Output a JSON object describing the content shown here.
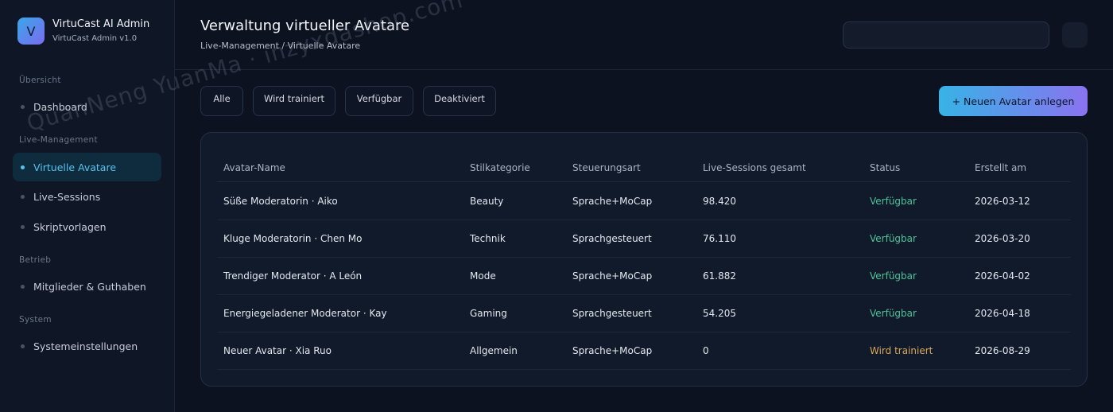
{
  "brand": {
    "logo_letter": "V",
    "title": "VirtuCast AI Admin",
    "subtitle": "VirtuCast Admin v1.0"
  },
  "sidebar": {
    "sections": [
      {
        "label": "Übersicht",
        "items": [
          {
            "label": "Dashboard",
            "active": false
          }
        ]
      },
      {
        "label": "Live-Management",
        "items": [
          {
            "label": "Virtuelle Avatare",
            "active": true
          },
          {
            "label": "Live-Sessions",
            "active": false
          },
          {
            "label": "Skriptvorlagen",
            "active": false
          }
        ]
      },
      {
        "label": "Betrieb",
        "items": [
          {
            "label": "Mitglieder & Guthaben",
            "active": false
          }
        ]
      },
      {
        "label": "System",
        "items": [
          {
            "label": "Systemeinstellungen",
            "active": false
          }
        ]
      }
    ]
  },
  "header": {
    "title": "Verwaltung virtueller Avatare",
    "breadcrumb": "Live-Management / Virtuelle Avatare",
    "search": {
      "value": "",
      "placeholder": ""
    }
  },
  "filters": [
    "Alle",
    "Wird trainiert",
    "Verfügbar",
    "Deaktiviert"
  ],
  "primary_action": "+ Neuen Avatar anlegen",
  "table": {
    "columns": [
      "Avatar-Name",
      "Stilkategorie",
      "Steuerungsart",
      "Live-Sessions gesamt",
      "Status",
      "Erstellt am"
    ],
    "rows": [
      [
        "Süße Moderatorin · Aiko",
        "Beauty",
        "Sprache+MoCap",
        "98.420",
        "Verfügbar",
        "2026-03-12"
      ],
      [
        "Kluge Moderatorin · Chen Mo",
        "Technik",
        "Sprachgesteuert",
        "76.110",
        "Verfügbar",
        "2026-03-20"
      ],
      [
        "Trendiger Moderator · A León",
        "Mode",
        "Sprache+MoCap",
        "61.882",
        "Verfügbar",
        "2026-04-02"
      ],
      [
        "Energiegeladener Moderator · Kay",
        "Gaming",
        "Sprachgesteuert",
        "54.205",
        "Verfügbar",
        "2026-04-18"
      ],
      [
        "Neuer Avatar · Xia Ruo",
        "Allgemein",
        "Sprache+MoCap",
        "0",
        "Wird trainiert",
        "2026-08-29"
      ]
    ]
  },
  "watermark": "QuanNeng YuanMa · inzyxdashop.com",
  "colors": {
    "accent": "#57c3ec",
    "status_available": "#4fc29a",
    "status_training": "#d8a75a"
  }
}
